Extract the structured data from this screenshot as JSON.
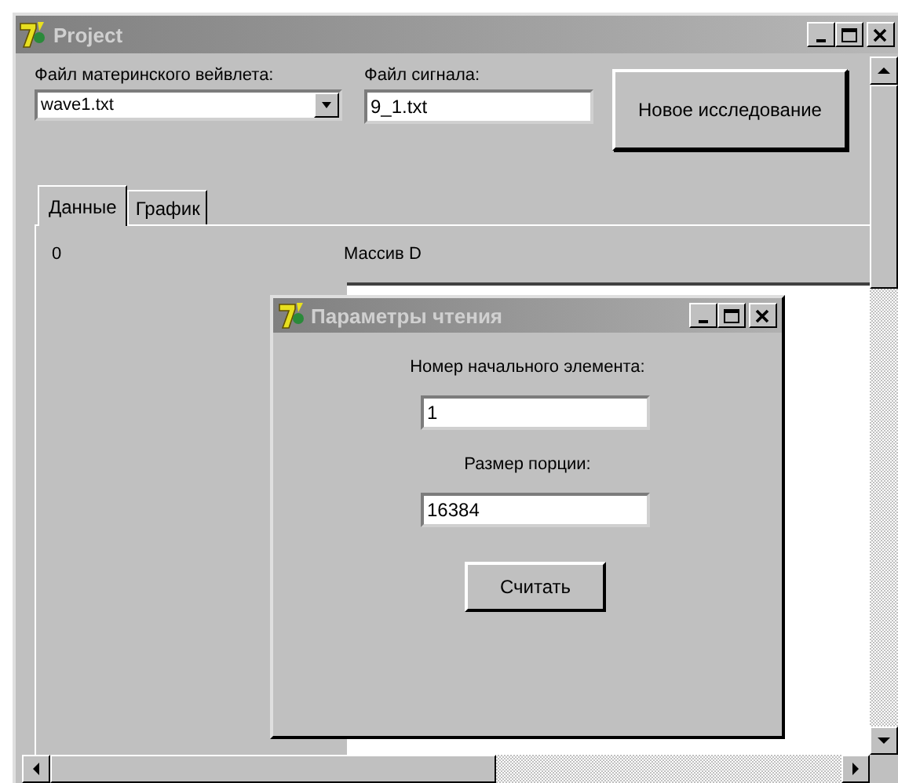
{
  "window": {
    "title": "Project"
  },
  "wavelet_file": {
    "label": "Файл материнского вейвлета:",
    "value": "wave1.txt"
  },
  "signal_file": {
    "label": "Файл сигнала:",
    "value": "9_1.txt"
  },
  "new_study_button": "Новое исследование",
  "tabs": [
    {
      "label": "Данные",
      "selected": true
    },
    {
      "label": "График",
      "selected": false
    }
  ],
  "tab_content": {
    "index_label": "0",
    "array_label": "Массив D"
  },
  "dialog": {
    "title": "Параметры чтения",
    "start_label": "Номер начального элемента:",
    "start_value": "1",
    "portion_label": "Размер порции:",
    "portion_value": "16384",
    "read_button": "Считать"
  }
}
